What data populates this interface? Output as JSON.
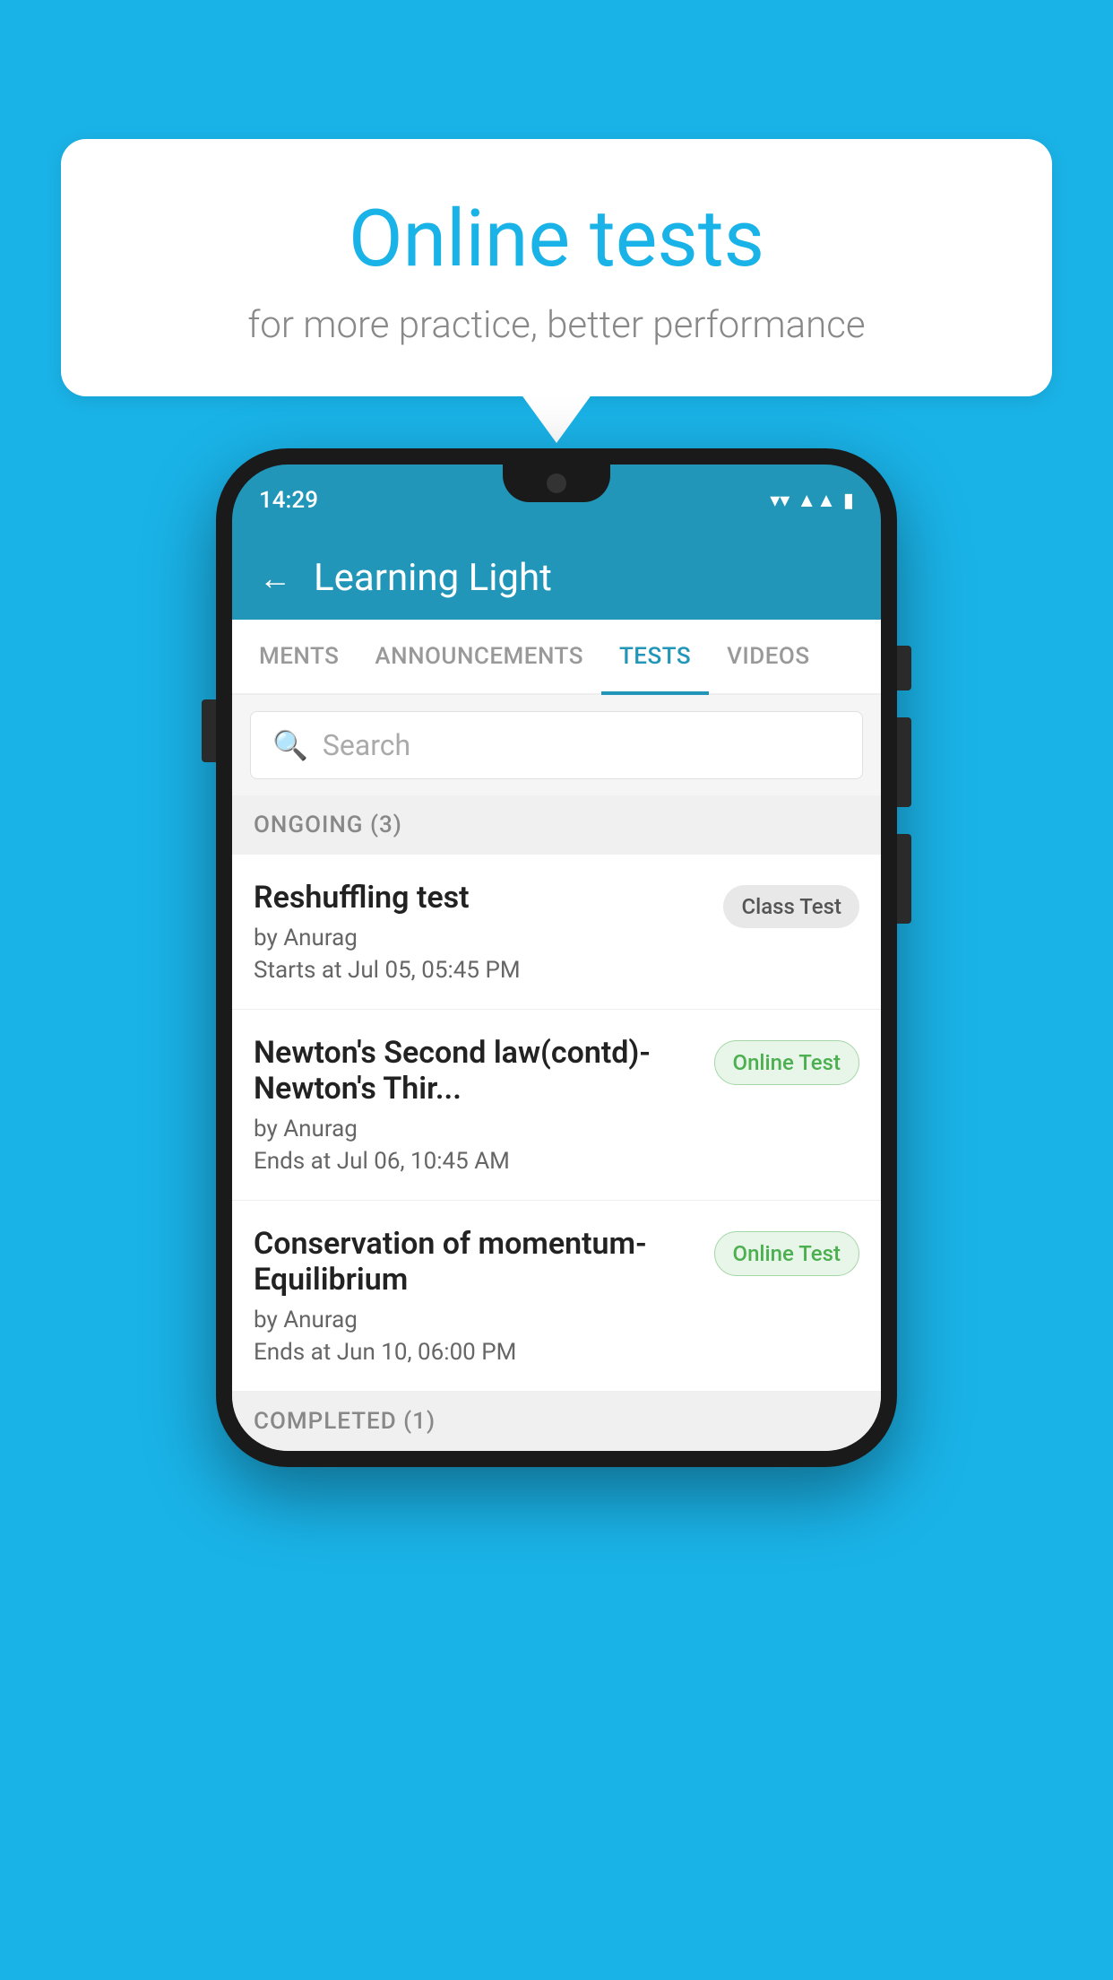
{
  "background_color": "#1ab3e8",
  "speech_bubble": {
    "title": "Online tests",
    "subtitle": "for more practice, better performance"
  },
  "phone": {
    "status_bar": {
      "time": "14:29",
      "icons": [
        "wifi",
        "signal",
        "battery"
      ]
    },
    "app_header": {
      "title": "Learning Light",
      "back_label": "←"
    },
    "tabs": [
      {
        "label": "MENTS",
        "active": false
      },
      {
        "label": "ANNOUNCEMENTS",
        "active": false
      },
      {
        "label": "TESTS",
        "active": true
      },
      {
        "label": "VIDEOS",
        "active": false
      }
    ],
    "search": {
      "placeholder": "Search"
    },
    "sections": [
      {
        "label": "ONGOING (3)",
        "items": [
          {
            "name": "Reshuffling test",
            "by": "by Anurag",
            "time": "Starts at  Jul 05, 05:45 PM",
            "badge": "Class Test",
            "badge_type": "class"
          },
          {
            "name": "Newton's Second law(contd)-Newton's Thir...",
            "by": "by Anurag",
            "time": "Ends at  Jul 06, 10:45 AM",
            "badge": "Online Test",
            "badge_type": "online"
          },
          {
            "name": "Conservation of momentum-Equilibrium",
            "by": "by Anurag",
            "time": "Ends at  Jun 10, 06:00 PM",
            "badge": "Online Test",
            "badge_type": "online"
          }
        ]
      }
    ],
    "completed_section_label": "COMPLETED (1)"
  }
}
